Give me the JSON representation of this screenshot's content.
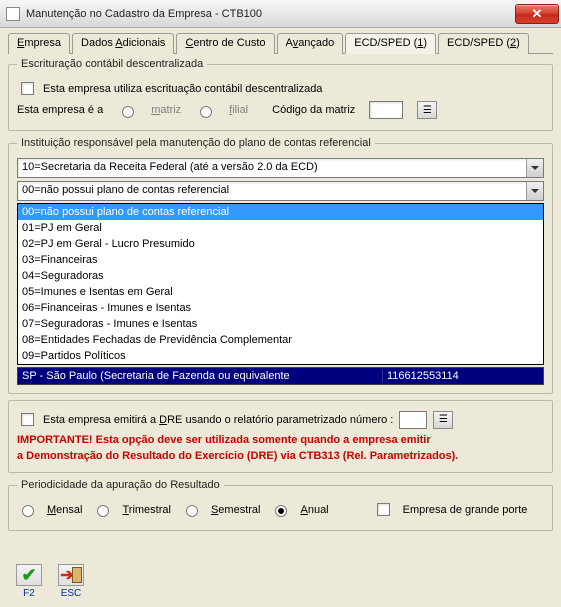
{
  "window": {
    "title": "Manutenção no Cadastro da Empresa - CTB100"
  },
  "tabs": [
    "Empresa",
    "Dados Adicionais",
    "Centro de Custo",
    "Avançado",
    "ECD/SPED (1)",
    "ECD/SPED (2)"
  ],
  "active_tab": 4,
  "group_escrit": {
    "legend": "Escrituração contábil descentralizada",
    "chk_label": "Esta empresa utiliza escrituação contábil descentralizada",
    "tipo_label": "Esta empresa é a",
    "radio_matriz": "matriz",
    "radio_filial": "filial",
    "codigo_label": "Código da matriz"
  },
  "group_inst": {
    "legend": "Instituição responsável pela manutenção do plano de contas referencial",
    "combo1": "10=Secretaria da Receita Federal (até a versão 2.0 da ECD)",
    "combo2": "00=não possui plano de contas referencial",
    "options": [
      "00=não possui plano de contas referencial",
      "01=PJ em Geral",
      "02=PJ em Geral - Lucro Presumido",
      "03=Financeiras",
      "04=Seguradoras",
      "05=Imunes e Isentas em Geral",
      "06=Financeiras - Imunes e Isentas",
      "07=Seguradoras - Imunes e Isentas",
      "08=Entidades Fechadas de Previdência Complementar",
      "09=Partidos Políticos"
    ],
    "row_label": "SP - São Paulo (Secretaria de Fazenda ou equivalente",
    "row_value": "116612553114"
  },
  "group_dre": {
    "chk_label_pre": "Esta empresa emitirá a ",
    "chk_label_u": "D",
    "chk_label_post": "RE usando o relatório parametrizado número :",
    "warn1": "IMPORTANTE! Esta opção deve ser utilizada somente quando a empresa emitir",
    "warn2": "a Demonstração do Resultado do Exercício (DRE) via CTB313 (Rel. Parametrizados)."
  },
  "group_period": {
    "legend": "Periodicidade da apuração do Resultado",
    "mensal": "Mensal",
    "trimestral": "Trimestral",
    "semestral": "Semestral",
    "anual": "Anual",
    "selected": "anual",
    "grande_porte": "Empresa de grande porte"
  },
  "footer": {
    "f2": "F2",
    "esc": "ESC"
  }
}
